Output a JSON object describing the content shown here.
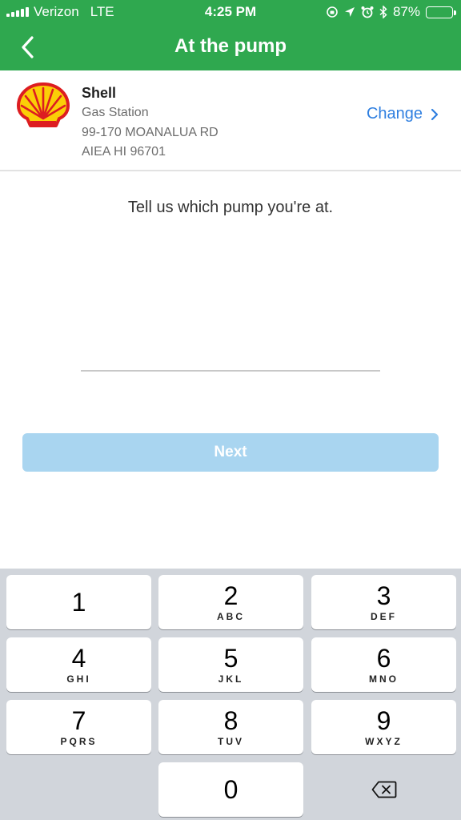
{
  "status_bar": {
    "carrier": "Verizon",
    "network": "LTE",
    "time": "4:25 PM",
    "battery_percent": "87%",
    "battery_level": 0.87
  },
  "nav": {
    "title": "At the pump",
    "back_icon": "chevron-left-icon"
  },
  "station": {
    "logo_icon": "shell-logo",
    "name": "Shell",
    "type": "Gas Station",
    "address_line1": "99-170 MOANALUA RD",
    "address_line2": "AIEA HI 96701",
    "change_label": "Change",
    "change_icon": "chevron-right-icon"
  },
  "main": {
    "prompt": "Tell us which pump you're at.",
    "pump_input_value": "",
    "next_label": "Next"
  },
  "keypad": {
    "keys": [
      {
        "digit": "1",
        "letters": ""
      },
      {
        "digit": "2",
        "letters": "ABC"
      },
      {
        "digit": "3",
        "letters": "DEF"
      },
      {
        "digit": "4",
        "letters": "GHI"
      },
      {
        "digit": "5",
        "letters": "JKL"
      },
      {
        "digit": "6",
        "letters": "MNO"
      },
      {
        "digit": "7",
        "letters": "PQRS"
      },
      {
        "digit": "8",
        "letters": "TUV"
      },
      {
        "digit": "9",
        "letters": "WXYZ"
      },
      {
        "digit": "0",
        "letters": ""
      }
    ],
    "backspace_icon": "backspace-icon"
  },
  "colors": {
    "header_green": "#2fa84f",
    "link_blue": "#2f7fe0",
    "next_disabled_blue": "#a9d5f0",
    "keypad_gray": "#d1d5db",
    "shell_red": "#dd1d21",
    "shell_yellow": "#fbce07"
  }
}
